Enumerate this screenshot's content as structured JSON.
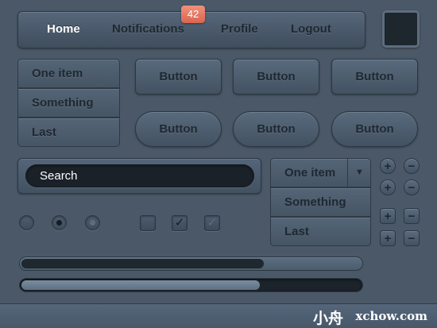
{
  "nav": {
    "items": [
      "Home",
      "Notifications",
      "Profile",
      "Logout"
    ],
    "active": "Home",
    "badge": "42"
  },
  "list": {
    "items": [
      "One item",
      "Something",
      "Last"
    ]
  },
  "buttons": {
    "square": [
      "Button",
      "Button",
      "Button"
    ],
    "rounded": [
      "Button",
      "Button",
      "Button"
    ]
  },
  "search": {
    "value": "",
    "placeholder": "Search"
  },
  "dropdown": {
    "selected": "One item",
    "options": [
      "Something",
      "Last"
    ],
    "arrow": "▼"
  },
  "steppers": {
    "plus": "+",
    "minus": "−"
  },
  "radios": {
    "selected_index": 1
  },
  "checkboxes": {
    "checked": [
      false,
      true,
      true
    ],
    "enabled": [
      true,
      true,
      false
    ],
    "mark": "✓"
  },
  "progress": {
    "bar1": 0.71,
    "bar2": 0.7
  },
  "watermark": {
    "cn": "小舟",
    "en": "xchow.com"
  },
  "colors": {
    "background": "#4a5867",
    "badge": "#e47a64",
    "input_bg": "#1a2128",
    "progress_dark": "#1f272f",
    "progress_light": "#6b7d8f"
  }
}
